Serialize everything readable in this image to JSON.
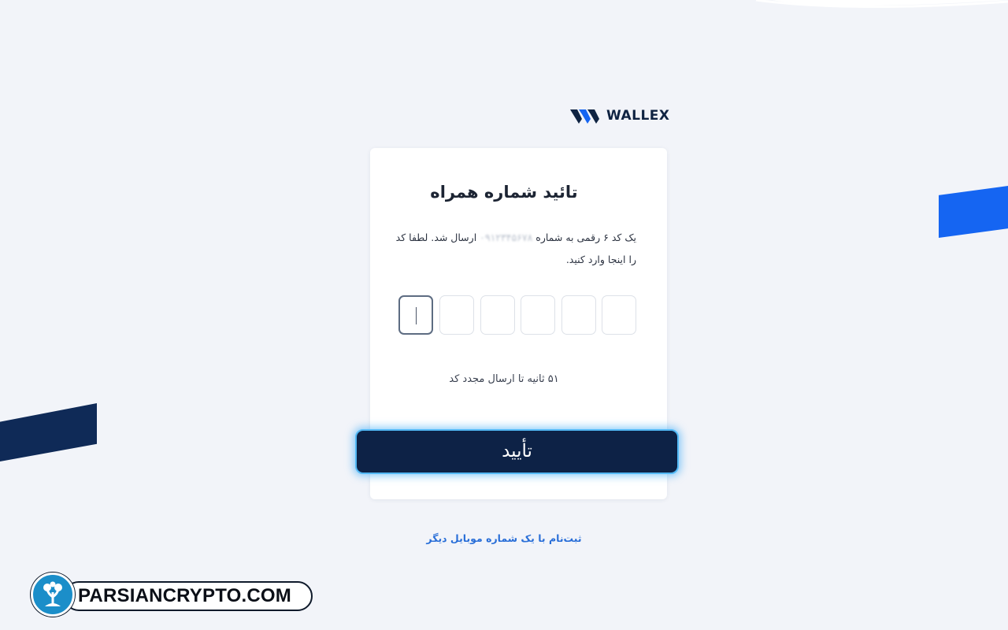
{
  "brand": {
    "logo_text": "WALLEX",
    "colors": {
      "primary_navy": "#0d2246",
      "accent_blue": "#1565f2",
      "link_blue": "#2a6fd8",
      "button_glow": "#53b9f5"
    }
  },
  "verify": {
    "title": "تائید شماره همراه",
    "desc_before": "یک کد ۶ رقمی به شماره",
    "masked_phone": "۰۹۱۲۳۴۵۶۷۸",
    "desc_after": "ارسال شد. لطفا کد را اینجا وارد کنید.",
    "otp_length": 6,
    "otp_values": [
      "",
      "",
      "",
      "",
      "",
      ""
    ],
    "resend_text": "۵۱ ثانیه تا ارسال مجدد کد",
    "confirm_label": "تأیید",
    "alt_link": "ثبت‌نام با یک شماره موبایل دیگر"
  },
  "watermark": {
    "text": "PARSIANCRYPTO.COM",
    "icon": "tree-icon"
  }
}
